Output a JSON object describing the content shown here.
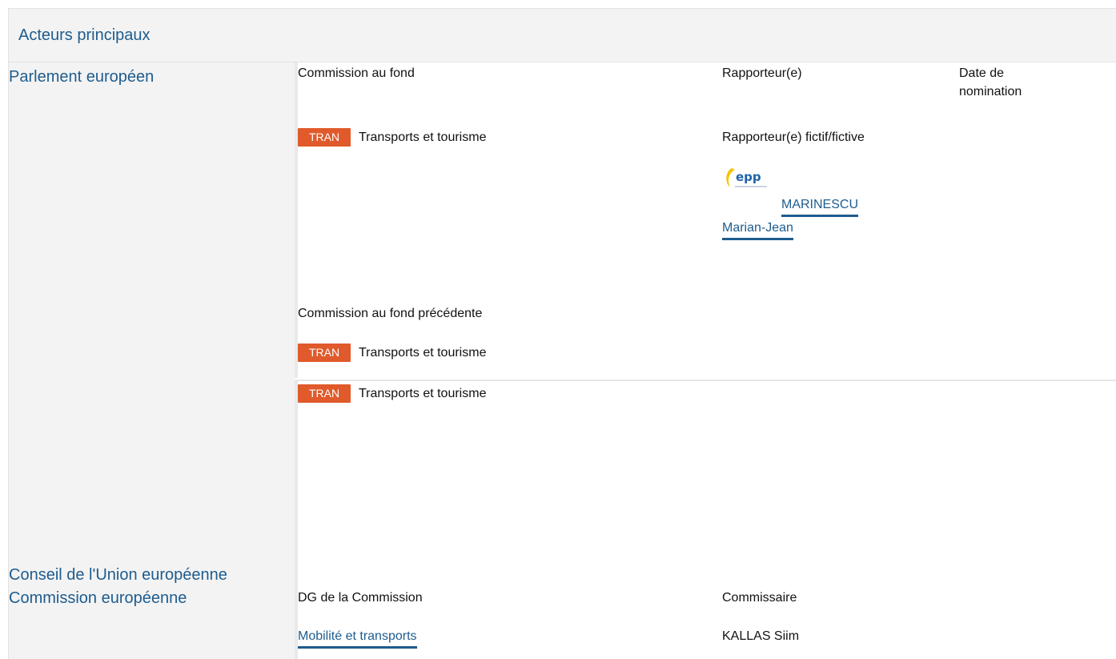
{
  "header": {
    "title": "Acteurs principaux"
  },
  "institutions": {
    "parliament": "Parlement européen",
    "council": "Conseil de l'Union européenne",
    "commission": "Commission européenne"
  },
  "parliament": {
    "col_committee": "Commission au fond",
    "col_rapporteur": "Rapporteur(e)",
    "col_date": "Date de nomination",
    "committee": {
      "code": "TRAN",
      "name": "Transports et tourisme"
    },
    "shadow_label": "Rapporteur(e) fictif/fictive",
    "shadow": {
      "group_logo": "epp-logo",
      "name_line1": "MARINESCU",
      "name_line2": "Marian-Jean"
    },
    "previous_label": "Commission au fond précédente",
    "previous_committee": {
      "code": "TRAN",
      "name": "Transports et tourisme"
    },
    "section2_committee": {
      "code": "TRAN",
      "name": "Transports et tourisme"
    }
  },
  "commission": {
    "col_dg": "DG de la Commission",
    "col_commissioner": "Commissaire",
    "dg": "Mobilité et transports",
    "commissioner": "KALLAS Siim"
  },
  "colors": {
    "accent_blue": "#1e5c8e",
    "badge_orange": "#e05a2b"
  }
}
